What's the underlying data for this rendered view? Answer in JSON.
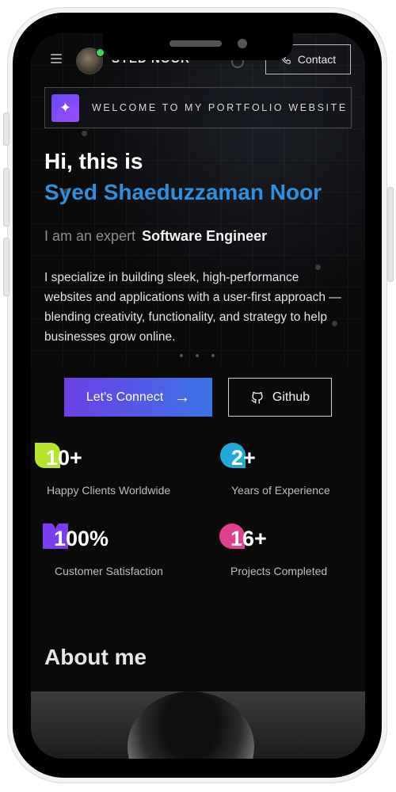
{
  "header": {
    "brand": "SYED  NOOR",
    "contact_label": "Contact"
  },
  "welcome": {
    "text": "WELCOME TO MY PORTFOLIO WEBSITE"
  },
  "hero": {
    "greeting": "Hi, this is",
    "name": "Syed Shaeduzzaman Noor",
    "expert_prefix": "I am an expert",
    "expert_role": "Software Engineer",
    "intro": "I specialize in building sleek, high-performance websites and applications with a user-first approach — blending creativity, functionality, and strategy to help businesses grow online.",
    "connect_label": "Let's Connect",
    "github_label": "Github"
  },
  "stats": [
    {
      "value": "10+",
      "label": "Happy Clients Worldwide",
      "color": "#b6e32c"
    },
    {
      "value": "2+",
      "label": "Years of Experience",
      "color": "#1fa9d6"
    },
    {
      "value": "100%",
      "label": "Customer Satisfaction",
      "color": "#7b3df0"
    },
    {
      "value": "16+",
      "label": "Projects Completed",
      "color": "#e0408f"
    }
  ],
  "about": {
    "title": "About me"
  },
  "colors": {
    "accent_blue": "#2f8fdd",
    "button_gradient_start": "#6d3fe6",
    "button_gradient_end": "#3b74e8"
  }
}
